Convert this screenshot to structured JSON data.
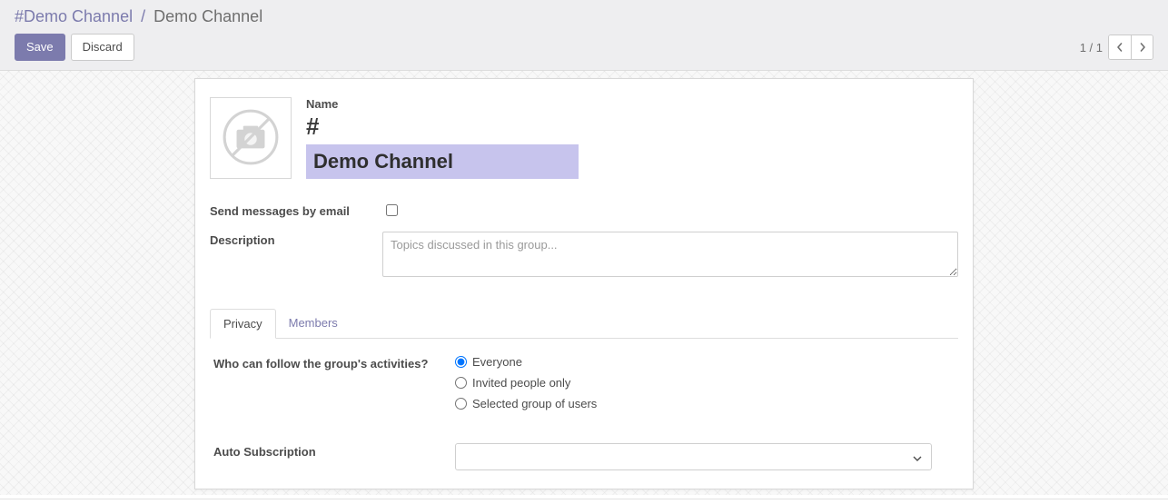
{
  "breadcrumb": {
    "root": "#Demo Channel",
    "sep": "/",
    "current": "Demo Channel"
  },
  "toolbar": {
    "save": "Save",
    "discard": "Discard"
  },
  "pager": {
    "text": "1 / 1"
  },
  "form": {
    "name_label": "Name",
    "name_prefix": "#",
    "name_value": "Demo Channel",
    "send_email_label": "Send messages by email",
    "send_email_checked": false,
    "description_label": "Description",
    "description_placeholder": "Topics discussed in this group...",
    "description_value": ""
  },
  "tabs": {
    "privacy": "Privacy",
    "members": "Members",
    "active": "privacy"
  },
  "privacy": {
    "follow_label": "Who can follow the group's activities?",
    "options": [
      {
        "label": "Everyone",
        "checked": true
      },
      {
        "label": "Invited people only",
        "checked": false
      },
      {
        "label": "Selected group of users",
        "checked": false
      }
    ],
    "auto_sub_label": "Auto Subscription",
    "auto_sub_value": ""
  }
}
